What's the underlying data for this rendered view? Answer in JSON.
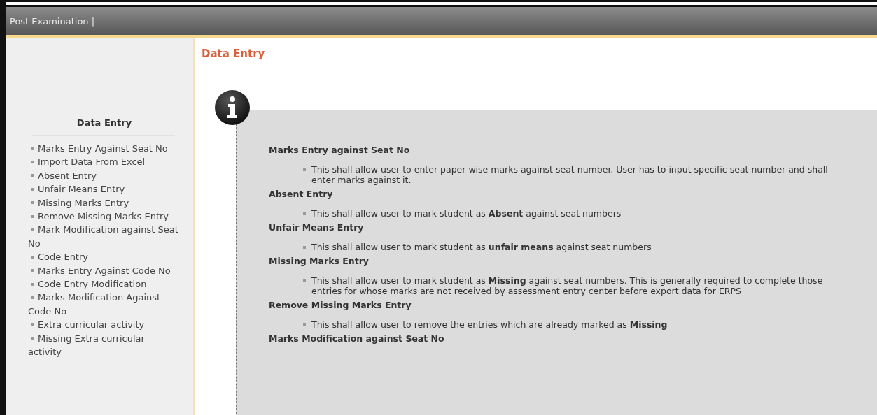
{
  "header": {
    "title": "Post Examination |"
  },
  "sidebar": {
    "title": "Data Entry",
    "items": [
      {
        "label": "Marks Entry Against Seat No"
      },
      {
        "label": "Import Data From Excel"
      },
      {
        "label": "Absent Entry"
      },
      {
        "label": "Unfair Means Entry"
      },
      {
        "label": "Missing Marks Entry"
      },
      {
        "label": "Remove Missing Marks Entry"
      },
      {
        "label": "Mark Modification against Seat No"
      },
      {
        "label": "Code Entry"
      },
      {
        "label": "Marks Entry Against Code No"
      },
      {
        "label": "Code Entry Modification"
      },
      {
        "label": "Marks Modification Against Code No"
      },
      {
        "label": "Extra curricular activity"
      },
      {
        "label": "Missing Extra curricular activity"
      }
    ]
  },
  "page": {
    "title": "Data Entry",
    "sections": [
      {
        "heading": "Marks Entry against Seat No",
        "description": "This shall allow user to enter paper wise marks against seat number. User has to input specific seat number and shall enter marks against it."
      },
      {
        "heading": "Absent Entry",
        "description": "This shall allow user to mark student as **Absent** against seat numbers"
      },
      {
        "heading": "Unfair Means Entry",
        "description": "This shall allow user to mark student as **unfair means** against seat numbers"
      },
      {
        "heading": "Missing Marks Entry",
        "description": "This shall allow user to mark student as **Missing** against seat numbers. This is generally required to complete those entries for whose marks are not received by assessment entry center before export data for ERPS"
      },
      {
        "heading": "Remove Missing Marks Entry",
        "description": "This shall allow user to remove the entries which are already marked as **Missing**"
      },
      {
        "heading": "Marks Modification against Seat No"
      }
    ]
  }
}
